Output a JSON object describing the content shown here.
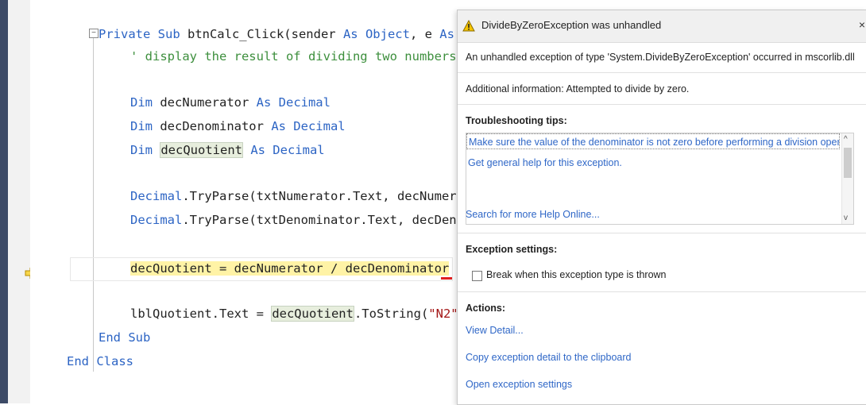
{
  "editor": {
    "code_lines": [
      {
        "kw1": "Private Sub ",
        "t1": "btnCalc_Click(sender ",
        "kw2": "As ",
        "kw3": "Object",
        "t2": ", e ",
        "kw4": "As"
      },
      {
        "comment": "' display the result of dividing two numbers"
      },
      {
        "kw1": "Dim ",
        "t1": "decNumerator ",
        "kw2": "As Decimal"
      },
      {
        "kw1": "Dim ",
        "t1": "decDenominator ",
        "kw2": "As Decimal"
      },
      {
        "kw1": "Dim ",
        "var": "decQuotient",
        "kw2": " As Decimal"
      },
      {
        "kw1": "Decimal",
        "t1": ".TryParse(txtNumerator.Text, decNumer"
      },
      {
        "kw1": "Decimal",
        "t1": ".TryParse(txtDenominator.Text, decDen"
      },
      {
        "t1": "decQuotient = decNumerator / decDenominator"
      },
      {
        "t1": "lblQuotient.Text = ",
        "var": "decQuotient",
        "t2": ".ToString(",
        "str": "\"N2\""
      },
      {
        "kw1": "End Sub"
      },
      {
        "kw1": "End Class"
      }
    ],
    "collapse_glyph": "−"
  },
  "popup": {
    "title": "DivideByZeroException was unhandled",
    "close": "×",
    "message": "An unhandled exception of type 'System.DivideByZeroException' occurred in mscorlib.dll",
    "additional_info": "Additional information: Attempted to divide by zero.",
    "troubleshooting_title": "Troubleshooting tips:",
    "tips": [
      "Make sure the value of the denominator is not zero before performing a division operation.",
      "Get general help for this exception."
    ],
    "search_help": "Search for more Help Online...",
    "exception_settings_title": "Exception settings:",
    "break_checkbox_label": "Break when this exception type is thrown",
    "actions_title": "Actions:",
    "actions": [
      "View Detail...",
      "Copy exception detail to the clipboard",
      "Open exception settings"
    ],
    "scroll_up": "^",
    "scroll_down": "v"
  },
  "icons": {
    "warning": "warning-icon",
    "execution_pointer": "execution-arrow-icon"
  },
  "colors": {
    "keyword": "#2c64c4",
    "comment": "#3d8f3d",
    "string": "#a31515",
    "link": "#2f67c7",
    "current_statement": "#fff3a6"
  }
}
